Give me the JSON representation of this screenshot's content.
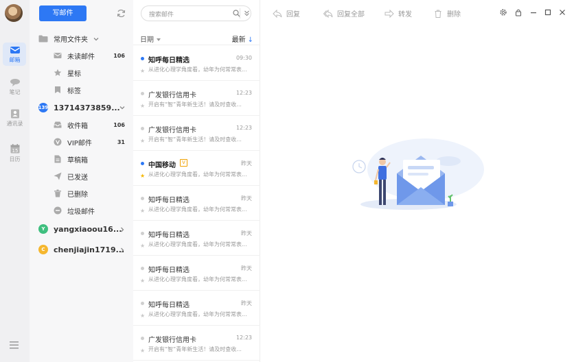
{
  "rail": {
    "items": [
      {
        "label": "邮箱",
        "icon": "mail-icon",
        "active": true
      },
      {
        "label": "笔记",
        "icon": "note-icon"
      },
      {
        "label": "通讯录",
        "icon": "contacts-icon"
      },
      {
        "label": "日历",
        "icon": "calendar-icon",
        "day": "15"
      }
    ]
  },
  "folders": {
    "compose_label": "写邮件",
    "common_group": "常用文件夹",
    "common_items": [
      {
        "label": "未读邮件",
        "icon": "unread-mail-icon",
        "count": "106"
      },
      {
        "label": "星标",
        "icon": "star-icon",
        "count": ""
      },
      {
        "label": "标签",
        "icon": "tag-icon",
        "count": ""
      }
    ],
    "account1": {
      "name": "13714373859...",
      "badge": "139",
      "badge_color": "#2d78f4"
    },
    "account1_items": [
      {
        "label": "收件箱",
        "icon": "inbox-icon",
        "count": "106"
      },
      {
        "label": "VIP邮件",
        "icon": "vip-icon",
        "count": "31"
      },
      {
        "label": "草稿箱",
        "icon": "draft-icon",
        "count": ""
      },
      {
        "label": "已发送",
        "icon": "sent-icon",
        "count": ""
      },
      {
        "label": "已删除",
        "icon": "trash-icon",
        "count": ""
      },
      {
        "label": "垃圾邮件",
        "icon": "spam-icon",
        "count": ""
      }
    ],
    "account2": {
      "name": "yangxiaoou16...",
      "badge": "Y",
      "badge_color": "#3fbf7f"
    },
    "account3": {
      "name": "chenjiajin1719...",
      "badge": "C",
      "badge_color": "#f5b72f"
    }
  },
  "list": {
    "search_placeholder": "搜索邮件",
    "sort_label": "日期",
    "order_label": "最新",
    "mails": [
      {
        "from": "知呼每日精选",
        "time": "09:30",
        "preview": "从进化心理学角度看，幼年为何常常表...",
        "unread": true,
        "starred": false,
        "vip": false
      },
      {
        "from": "广发银行信用卡",
        "time": "12:23",
        "preview": "开启有“智”青年新生活！请及时查收...",
        "unread": false,
        "starred": false,
        "vip": false
      },
      {
        "from": "广发银行信用卡",
        "time": "12:23",
        "preview": "开启有“智”青年新生活！请及时查收...",
        "unread": false,
        "starred": false,
        "vip": false
      },
      {
        "from": "中国移动",
        "time": "昨天",
        "preview": "从进化心理学角度看，幼年为何常常表...",
        "unread": true,
        "starred": true,
        "vip": true
      },
      {
        "from": "知呼每日精选",
        "time": "昨天",
        "preview": "从进化心理学角度看，幼年为何常常表...",
        "unread": false,
        "starred": false,
        "vip": false
      },
      {
        "from": "知呼每日精选",
        "time": "昨天",
        "preview": "从进化心理学角度看，幼年为何常常表...",
        "unread": false,
        "starred": false,
        "vip": false
      },
      {
        "from": "知呼每日精选",
        "time": "昨天",
        "preview": "从进化心理学角度看，幼年为何常常表...",
        "unread": false,
        "starred": false,
        "vip": false
      },
      {
        "from": "知呼每日精选",
        "time": "昨天",
        "preview": "从进化心理学角度看，幼年为何常常表...",
        "unread": false,
        "starred": false,
        "vip": false
      },
      {
        "from": "广发银行信用卡",
        "time": "12:23",
        "preview": "开启有“智”青年新生活！请及时查收...",
        "unread": false,
        "starred": false,
        "vip": false
      }
    ],
    "vip_mark": "V"
  },
  "toolbar": {
    "reply": "回复",
    "reply_all": "回复全部",
    "forward": "转发",
    "delete": "删除"
  },
  "colors": {
    "accent": "#2d78f4",
    "star": "#f5b700"
  }
}
